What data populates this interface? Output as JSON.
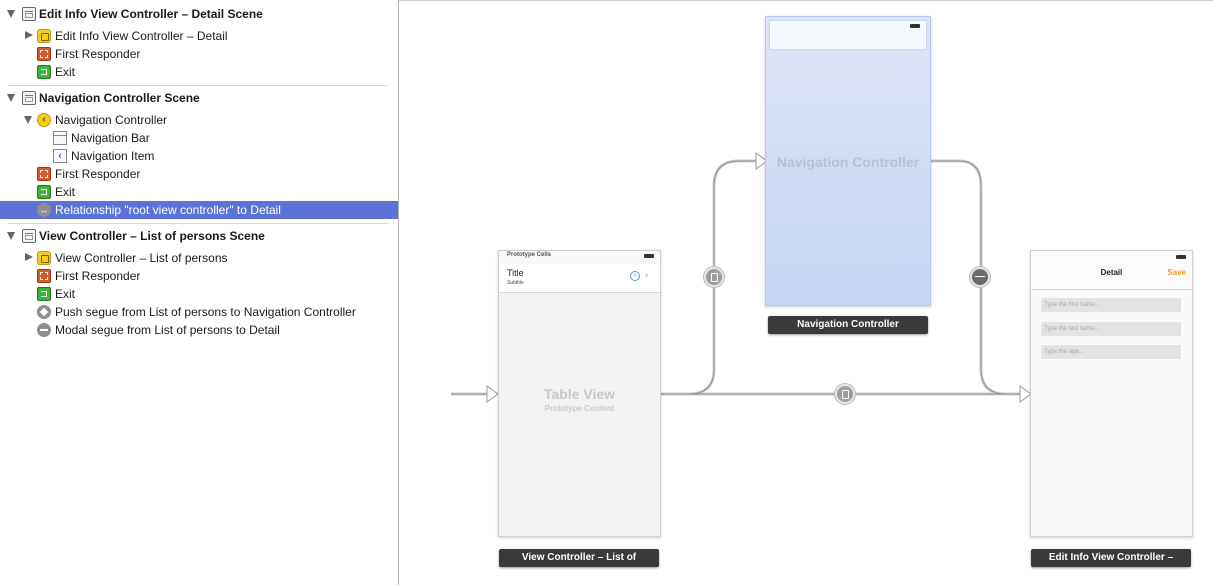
{
  "outline": {
    "scenes": [
      {
        "title": "Edit Info View Controller – Detail Scene",
        "items": [
          {
            "label": "Edit Info View Controller – Detail",
            "icon": "view-controller-icon"
          },
          {
            "label": "First Responder",
            "icon": "first-responder-icon"
          },
          {
            "label": "Exit",
            "icon": "exit-icon"
          }
        ]
      },
      {
        "title": "Navigation Controller Scene",
        "items": [
          {
            "label": "Navigation Controller",
            "icon": "navigation-controller-icon"
          },
          {
            "label": "Navigation Bar",
            "icon": "navigation-bar-icon"
          },
          {
            "label": "Navigation Item",
            "icon": "navigation-item-icon"
          },
          {
            "label": "First Responder",
            "icon": "first-responder-icon"
          },
          {
            "label": "Exit",
            "icon": "exit-icon"
          },
          {
            "label": "Relationship \"root view controller\" to Detail",
            "icon": "relationship-segue-icon",
            "selected": true
          }
        ]
      },
      {
        "title": "View Controller – List of persons Scene",
        "items": [
          {
            "label": "View Controller – List of persons",
            "icon": "view-controller-icon"
          },
          {
            "label": "First Responder",
            "icon": "first-responder-icon"
          },
          {
            "label": "Exit",
            "icon": "exit-icon"
          },
          {
            "label": "Push segue from List of persons to Navigation Controller",
            "icon": "push-segue-icon"
          },
          {
            "label": "Modal segue from List of persons to Detail",
            "icon": "modal-segue-icon"
          }
        ]
      }
    ]
  },
  "canvas": {
    "table_scene": {
      "header": "Prototype Cells",
      "cell_title": "Title",
      "cell_subtitle": "Subtitle",
      "placeholder_title": "Table View",
      "placeholder_subtitle": "Prototype Content",
      "label": "View Controller – List of"
    },
    "nav_scene": {
      "placeholder": "Navigation Controller",
      "label": "Navigation Controller"
    },
    "detail_scene": {
      "nav_title": "Detail",
      "save": "Save",
      "fields": [
        "Type the first name...",
        "Type the last name...",
        "Type the age..."
      ],
      "label": "Edit Info View Controller –"
    }
  },
  "colors": {
    "selection": "#5b72d6",
    "nav_tint": "#cfdaf5",
    "save_tint": "#f39c1f"
  }
}
